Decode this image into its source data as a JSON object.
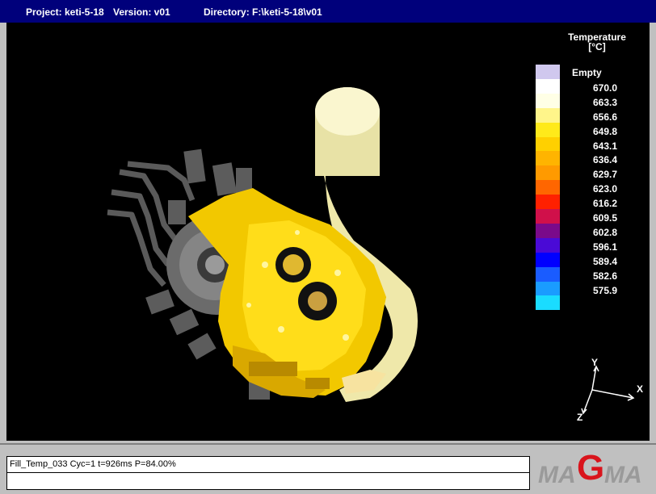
{
  "titlebar": {
    "project": "Project: keti-5-18",
    "version": "Version: v01",
    "directory": "Directory: F:\\keti-5-18\\v01"
  },
  "legend": {
    "title_line1": "Temperature",
    "title_line2": "[°C]",
    "empty_label": "Empty",
    "entries": [
      {
        "label": "670.0",
        "color": "#ffffe6"
      },
      {
        "label": "663.3",
        "color": "#fff58a"
      },
      {
        "label": "656.6",
        "color": "#ffea1a"
      },
      {
        "label": "649.8",
        "color": "#ffd000"
      },
      {
        "label": "643.1",
        "color": "#ffb400"
      },
      {
        "label": "636.4",
        "color": "#ff9a00"
      },
      {
        "label": "629.7",
        "color": "#ff6600"
      },
      {
        "label": "623.0",
        "color": "#ff2000"
      },
      {
        "label": "616.2",
        "color": "#d0104a"
      },
      {
        "label": "609.5",
        "color": "#7a0a8a"
      },
      {
        "label": "602.8",
        "color": "#4a0ad6"
      },
      {
        "label": "596.1",
        "color": "#0000ff"
      },
      {
        "label": "589.4",
        "color": "#1a5cff"
      },
      {
        "label": "582.6",
        "color": "#1a9cff"
      },
      {
        "label": "575.9",
        "color": "#1adcff"
      }
    ],
    "empty_color": "#d0c8ee"
  },
  "axes": {
    "y": "Y",
    "x": "X",
    "z": "Z"
  },
  "status": {
    "text": "Fill_Temp_033 Cyc=1 t=926ms P=84.00%"
  },
  "logo": {
    "text_left": "MA",
    "text_g": "G",
    "text_right": "MA",
    "brand_color": "#d9141c"
  }
}
